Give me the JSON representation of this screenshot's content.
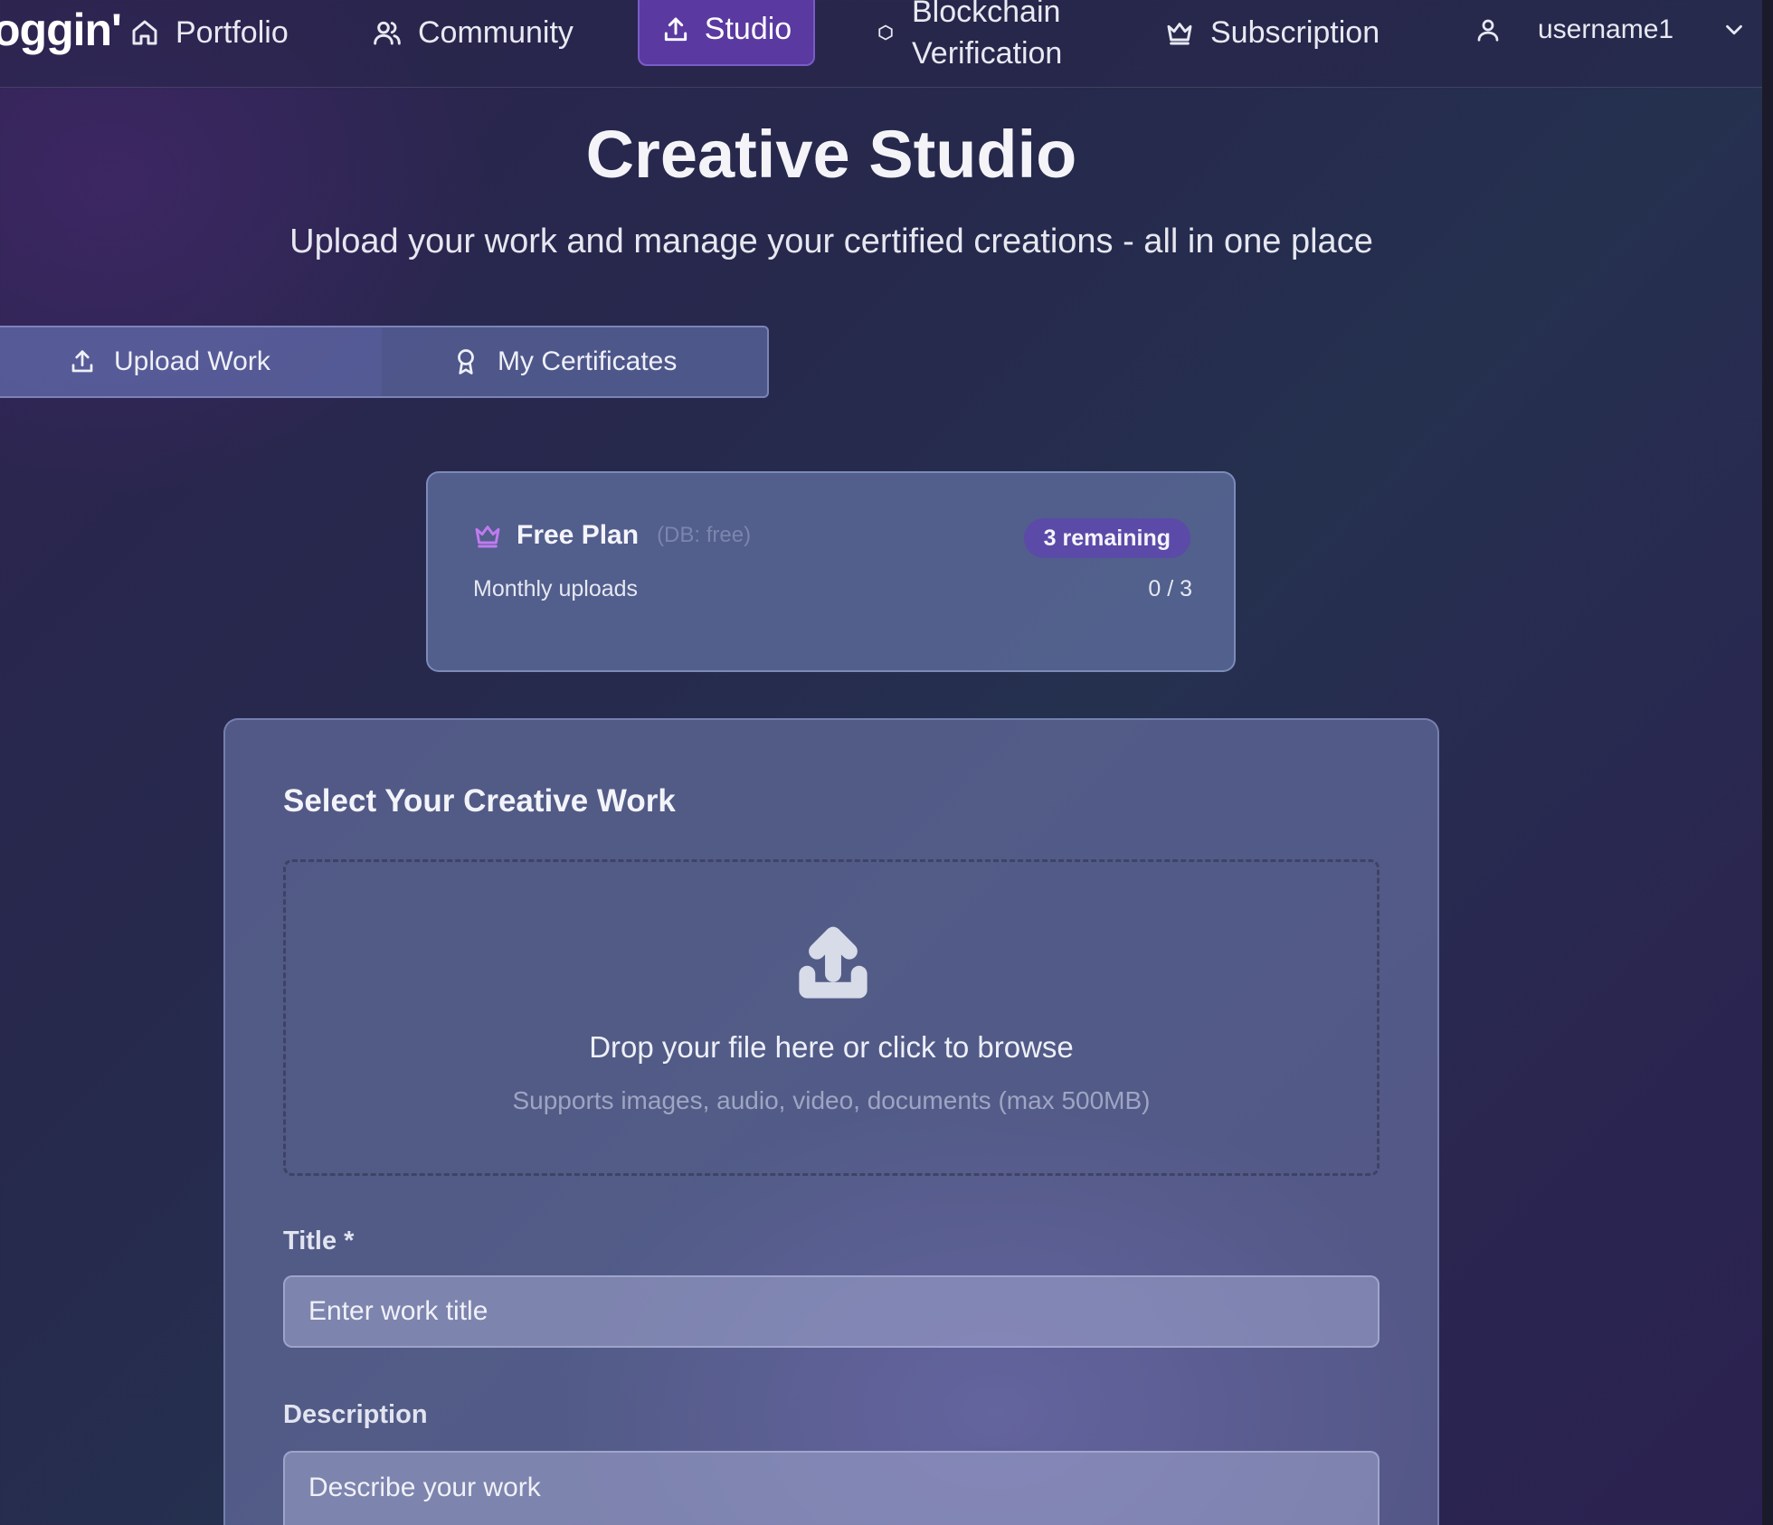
{
  "nav": {
    "brand": "oggin'",
    "items": [
      {
        "label": "Portfolio",
        "icon": "home-icon"
      },
      {
        "label": "Community",
        "icon": "users-icon"
      },
      {
        "label": "Studio",
        "icon": "upload-icon",
        "active": true
      },
      {
        "label_line1": "Blockchain",
        "label_line2": "Verification",
        "icon": "hexagon-icon"
      },
      {
        "label": "Subscription",
        "icon": "crown-icon"
      }
    ],
    "username": "username1"
  },
  "hero": {
    "title": "Creative Studio",
    "subtitle": "Upload your work and manage your certified creations - all in one place"
  },
  "tabs": [
    {
      "label": "Upload Work",
      "icon": "upload-icon",
      "active": true
    },
    {
      "label": "My Certificates",
      "icon": "award-icon"
    }
  ],
  "plan": {
    "name": "Free Plan",
    "db_note": "(DB: free)",
    "badge": "3 remaining",
    "row_label": "Monthly uploads",
    "row_value": "0 / 3",
    "accent": "#c07bf0"
  },
  "upload_form": {
    "section_title": "Select Your Creative Work",
    "dropzone_main": "Drop your file here or click to browse",
    "dropzone_sub": "Supports images, audio, video, documents (max 500MB)",
    "title_label": "Title *",
    "title_placeholder": "Enter work title",
    "description_label": "Description",
    "description_placeholder": "Describe your work"
  },
  "colors": {
    "studio_active": "#5a3aa0",
    "badge_bg": "#5b4aa8"
  }
}
